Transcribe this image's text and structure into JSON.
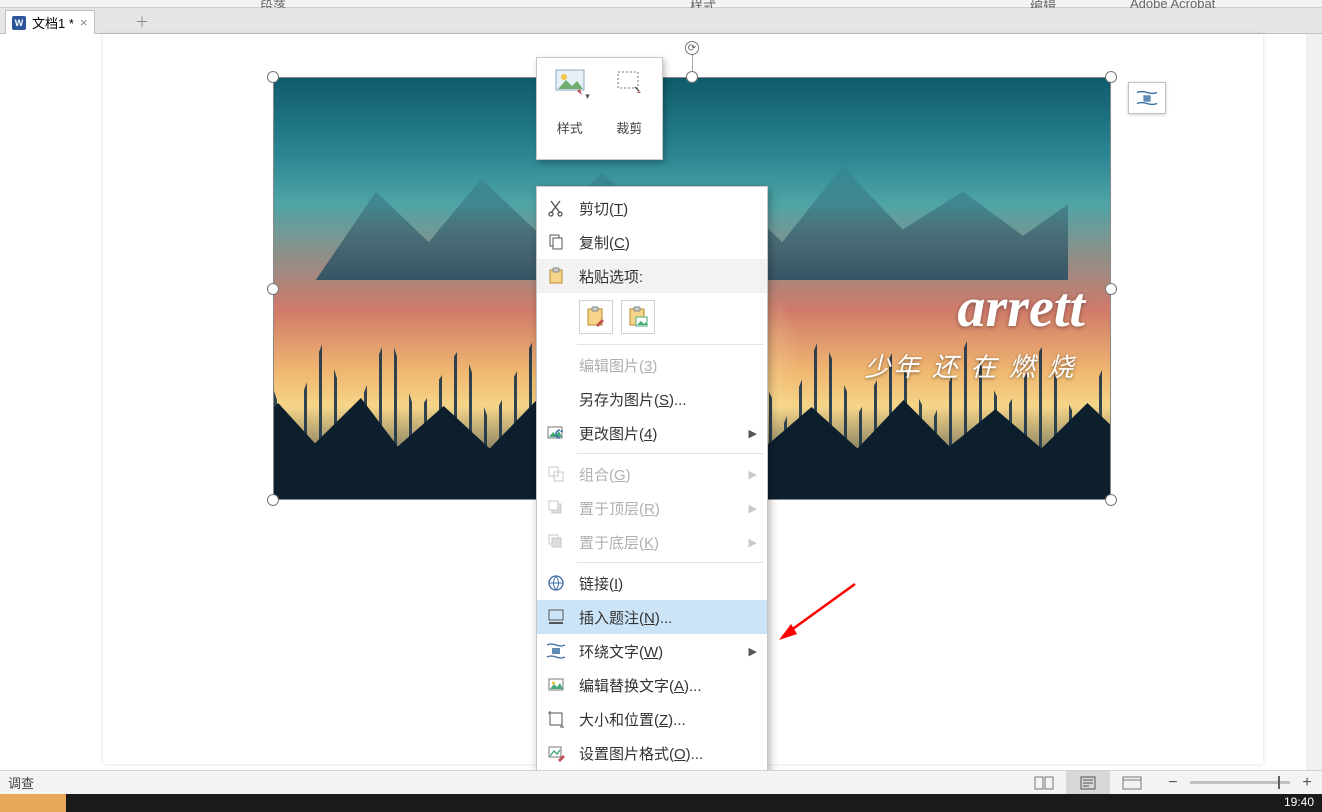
{
  "ribbon": {
    "frag1": "段落",
    "frag2": "样式",
    "frag3": "编辑",
    "frag4": "Adobe Acrobat"
  },
  "tab": {
    "title": "文档1 *"
  },
  "mini_toolbar": {
    "style": "样式",
    "crop": "裁剪"
  },
  "image_text": {
    "main": "arrett",
    "sub": "少年 还 在 燃 烧"
  },
  "ctx": {
    "cut": "剪切(T)",
    "copy": "复制(C)",
    "paste_header": "粘贴选项:",
    "edit_pic": "编辑图片(3)",
    "save_as_pic": "另存为图片(S)...",
    "change_pic": "更改图片(4)",
    "group": "组合(G)",
    "bring_front": "置于顶层(R)",
    "send_back": "置于底层(K)",
    "link": "链接(I)",
    "insert_caption": "插入题注(N)...",
    "wrap_text": "环绕文字(W)",
    "alt_text": "编辑替换文字(A)...",
    "size_pos": "大小和位置(Z)...",
    "format_pic": "设置图片格式(O)..."
  },
  "status": {
    "left": "调查",
    "time": "19:40"
  }
}
